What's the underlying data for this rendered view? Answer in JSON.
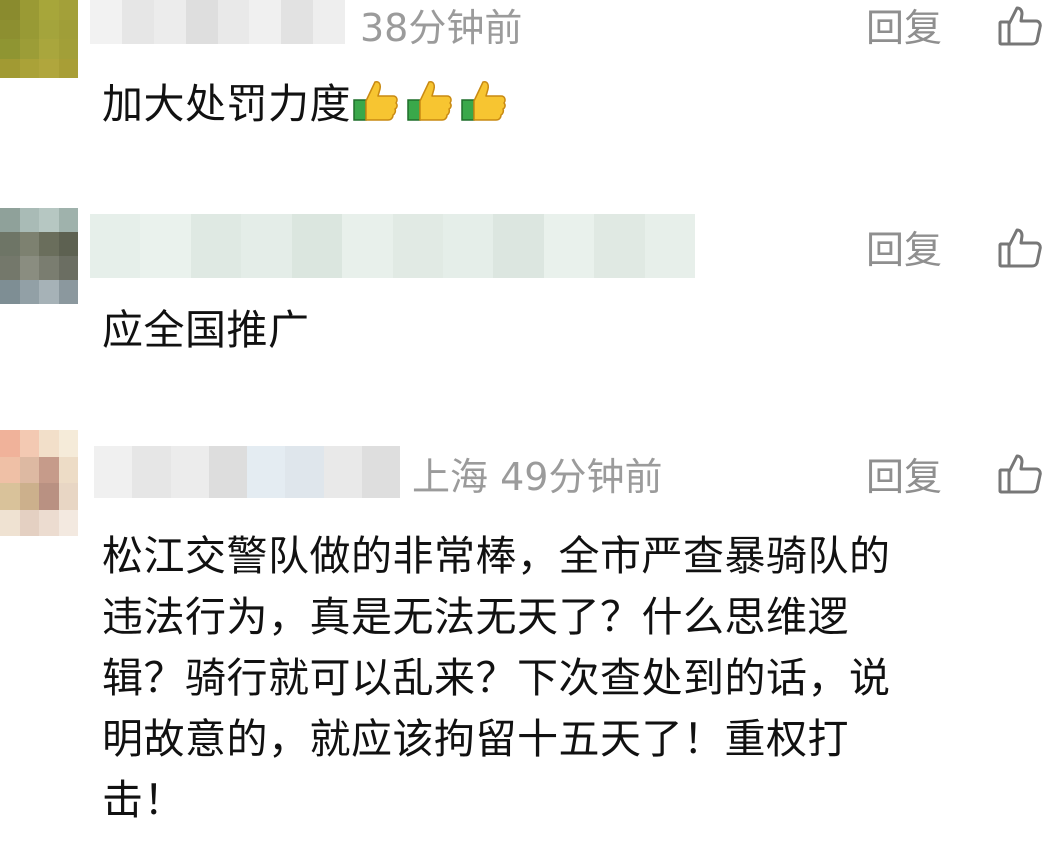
{
  "comments": [
    {
      "time": "38分钟前",
      "location": "",
      "reply_label": "回复",
      "text": "加大处罚力度",
      "emoji": [
        "thumbs-up",
        "thumbs-up",
        "thumbs-up"
      ]
    },
    {
      "time": "",
      "location": "",
      "reply_label": "回复",
      "text": "应全国推广",
      "emoji": []
    },
    {
      "time": "49分钟前",
      "location": "上海",
      "reply_label": "回复",
      "text_lines": [
        "松江交警队做的非常棒，全市严查暴骑队的",
        "违法行为，真是无法无天了？什么思维逻",
        "辑？骑行就可以乱来？下次查处到的话，说",
        "明故意的，就应该拘留十五天了！重权打",
        "击！"
      ]
    }
  ],
  "icons": {
    "like": "thumbs-up-outline-icon",
    "emoji": "thumbs-up-emoji"
  },
  "colors": {
    "meta_text": "#9b9b9b",
    "body_text": "#111111",
    "background": "#ffffff"
  }
}
